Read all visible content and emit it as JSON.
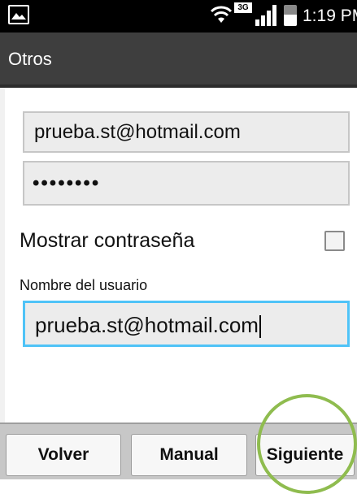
{
  "status_bar": {
    "network_badge": "3G",
    "time": "1:19 PM",
    "icons": [
      "gallery-icon",
      "wifi-icon",
      "signal-icon",
      "battery-icon"
    ]
  },
  "header": {
    "title": "Otros"
  },
  "form": {
    "email_value": "prueba.st@hotmail.com",
    "password_value": "••••••••",
    "show_password_label": "Mostrar contraseña",
    "show_password_checked": false,
    "username_label": "Nombre del usuario",
    "username_value": "prueba.st@hotmail.com"
  },
  "buttons": {
    "back": "Volver",
    "manual": "Manual",
    "next": "Siguiente"
  },
  "colors": {
    "focus_border": "#4fc3f7",
    "highlight_circle": "#8fbc4f",
    "title_bar": "#3e3e3e"
  }
}
